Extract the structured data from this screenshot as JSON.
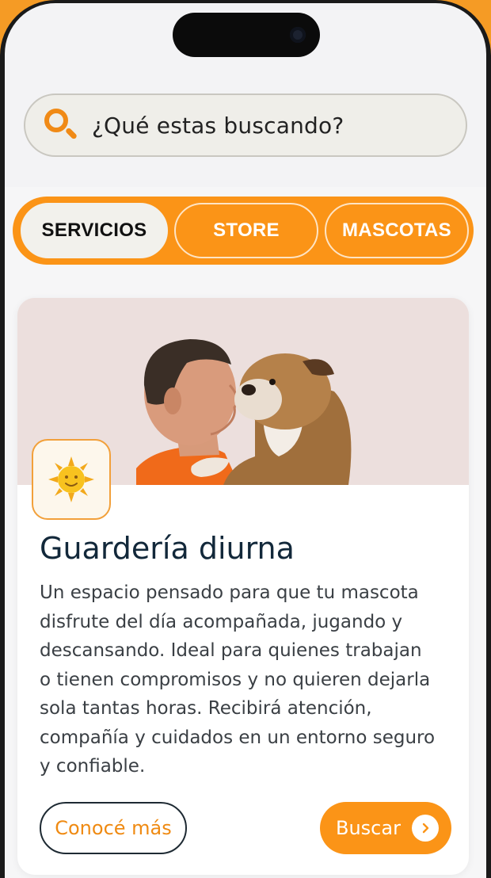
{
  "search": {
    "placeholder": "¿Qué estas buscando?"
  },
  "tabs": [
    {
      "label": "SERVICIOS",
      "active": true
    },
    {
      "label": "STORE",
      "active": false
    },
    {
      "label": "MASCOTAS",
      "active": false
    }
  ],
  "card": {
    "icon": "sun-icon",
    "title": "Guardería diurna",
    "description_lines": [
      "Un espacio pensado para que tu mascota",
      "disfrute del día acompañada, jugando y",
      "descansando. Ideal para quienes trabajan",
      "o tienen compromisos y no quieren dejarla",
      "sola tantas horas. Recibirá atención,",
      "compañía y cuidados en un entorno seguro",
      "y confiable."
    ],
    "secondary_button": "Conocé más",
    "primary_button": "Buscar"
  },
  "colors": {
    "accent": "#fb9417",
    "frame": "#f59b25",
    "title": "#12283a"
  }
}
